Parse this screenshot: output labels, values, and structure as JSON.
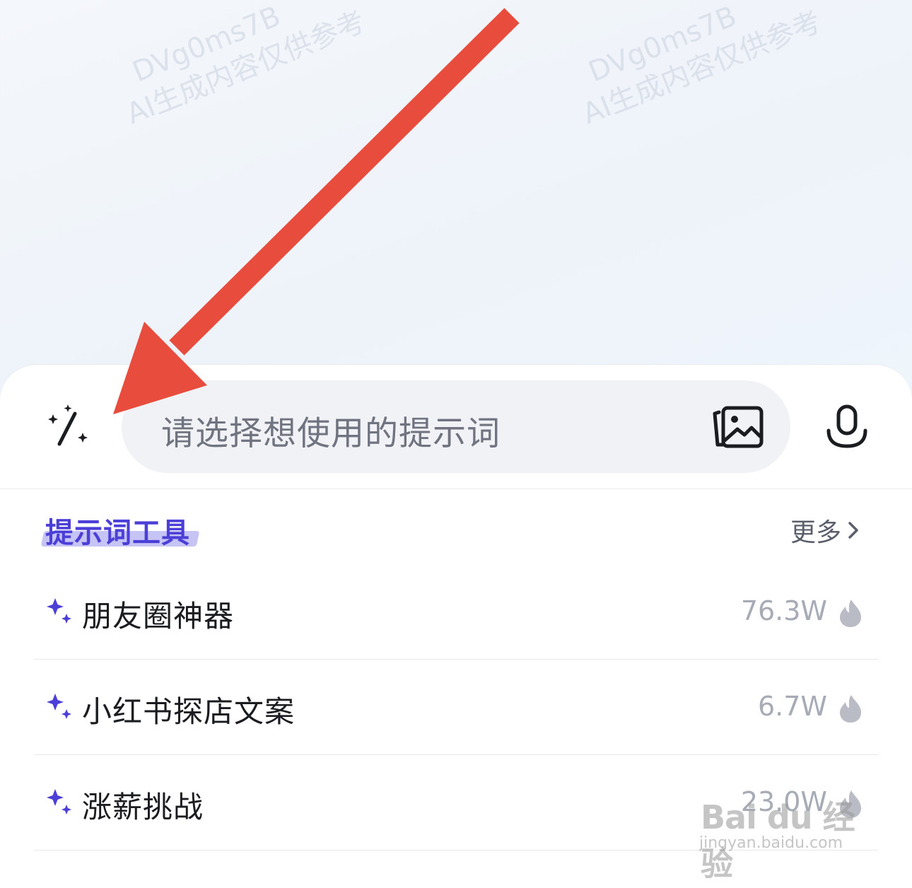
{
  "watermark": {
    "line1": "DVg0ms7B",
    "line2": "AI生成内容仅供参考"
  },
  "input": {
    "placeholder": "请选择想使用的提示词",
    "left_icon": "sparkle-slash-icon",
    "image_icon": "image-icon",
    "mic_icon": "microphone-icon"
  },
  "section": {
    "title": "提示词工具",
    "more_label": "更多"
  },
  "prompts": [
    {
      "label": "朋友圈神器",
      "count": "76.3W"
    },
    {
      "label": "小红书探店文案",
      "count": "6.7W"
    },
    {
      "label": "涨薪挑战",
      "count": "23.0W"
    }
  ],
  "baidu_watermark": {
    "brand": "Bai du 经验",
    "site": "jingyan.baidu.com"
  },
  "colors": {
    "accent": "#4b3fd8",
    "arrow": "#e84c3d",
    "muted": "#a7abb5"
  }
}
